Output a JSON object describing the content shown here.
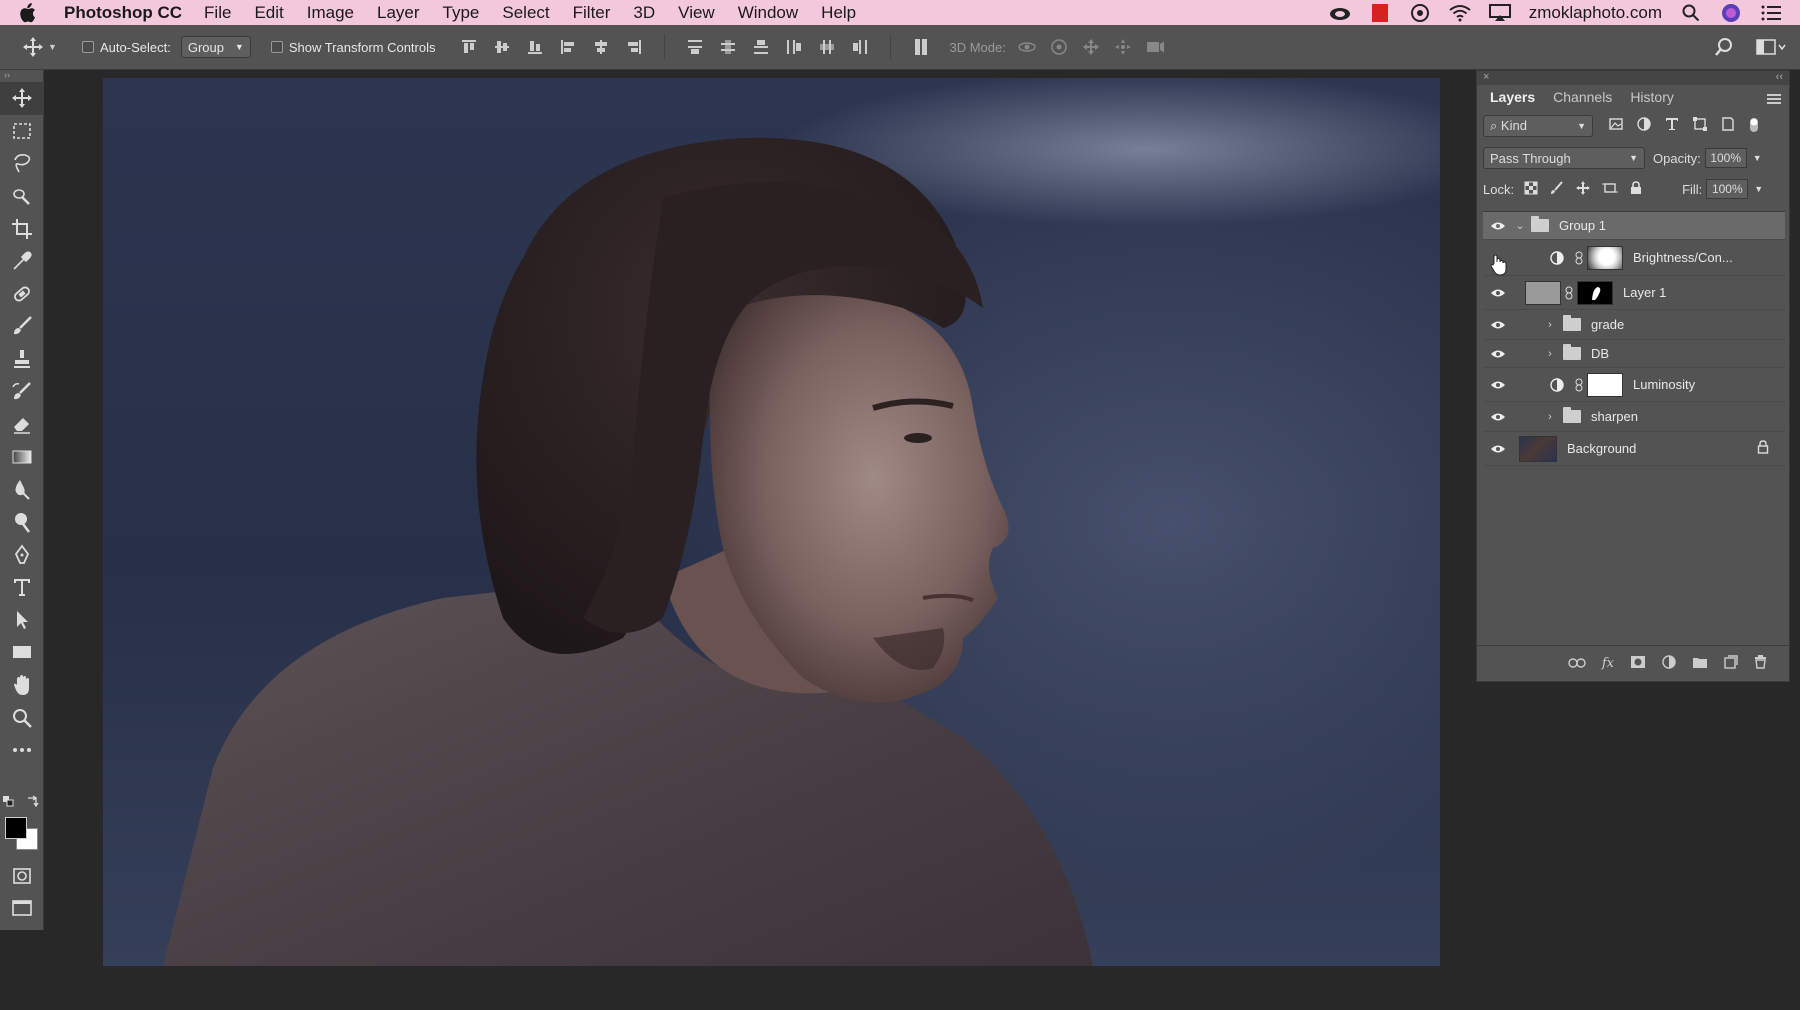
{
  "menubar": {
    "app_name": "Photoshop CC",
    "items": [
      "File",
      "Edit",
      "Image",
      "Layer",
      "Type",
      "Select",
      "Filter",
      "3D",
      "View",
      "Window",
      "Help"
    ],
    "site": "zmoklaphoto.com"
  },
  "options": {
    "auto_select_label": "Auto-Select:",
    "auto_select_value": "Group",
    "transform_label": "Show Transform Controls",
    "mode_3d_label": "3D Mode:"
  },
  "panel": {
    "tabs": [
      "Layers",
      "Channels",
      "History"
    ],
    "kind_label": "Kind",
    "blend_mode": "Pass Through",
    "opacity_label": "Opacity:",
    "opacity_value": "100%",
    "lock_label": "Lock:",
    "fill_label": "Fill:",
    "fill_value": "100%"
  },
  "layers": [
    {
      "name": "Group 1",
      "type": "group-open",
      "selected": true
    },
    {
      "name": "Brightness/Con...",
      "type": "adjustment",
      "mask": "white-blob",
      "visible": false
    },
    {
      "name": "Layer 1",
      "type": "pixel-mask",
      "mask": "black-white"
    },
    {
      "name": "grade",
      "type": "group"
    },
    {
      "name": "DB",
      "type": "group"
    },
    {
      "name": "Luminosity",
      "type": "adjustment",
      "mask": "white"
    },
    {
      "name": "sharpen",
      "type": "group"
    },
    {
      "name": "Background",
      "type": "background",
      "locked": true
    }
  ],
  "colors": {
    "menubar_bg": "#f4c8dc",
    "ui_gray": "#535353",
    "workspace": "#282828"
  }
}
